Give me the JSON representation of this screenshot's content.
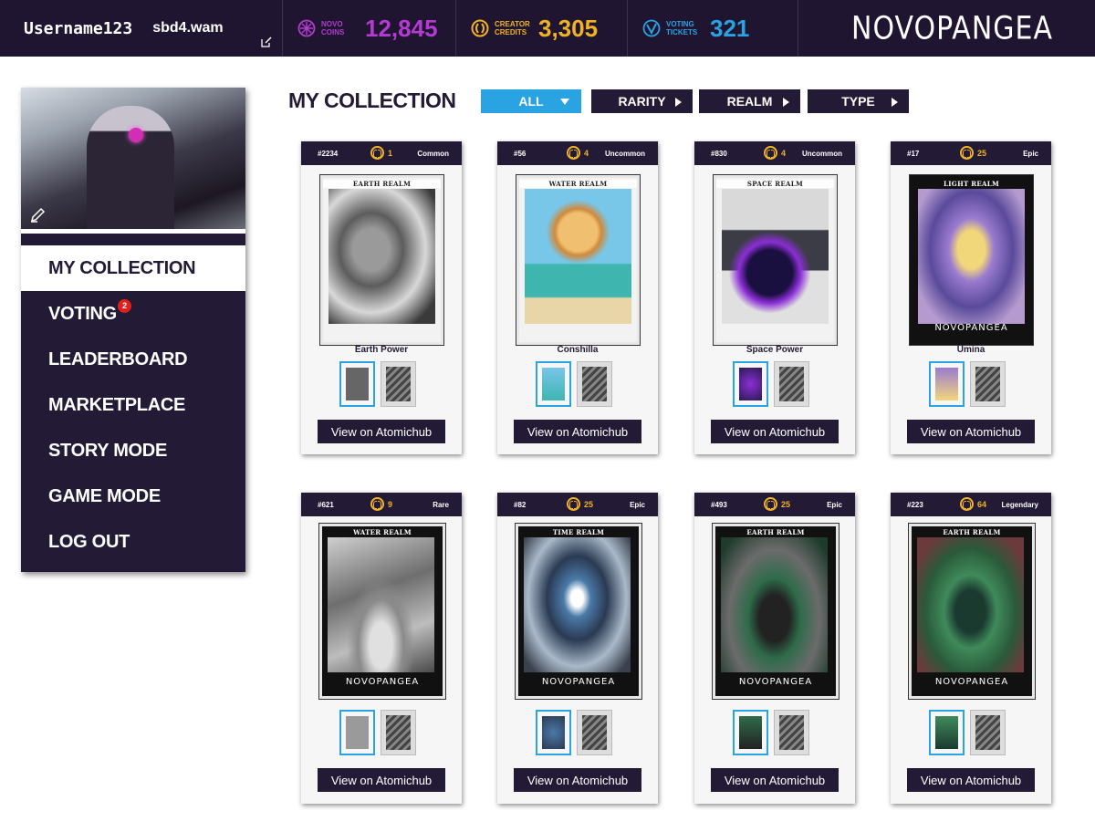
{
  "header": {
    "username": "Username123",
    "wallet": "sbd4.wam",
    "stats": [
      {
        "label": "Novo Coins",
        "value": "12,845",
        "color": "#b33bd1",
        "icon": "novo-coin-icon"
      },
      {
        "label": "Creator Credits",
        "value": "3,305",
        "color": "#f0b323",
        "icon": "creator-credit-icon"
      },
      {
        "label": "Voting Tickets",
        "value": "321",
        "color": "#29a3e2",
        "icon": "voting-ticket-icon"
      }
    ],
    "logo": "NOVOPANGEA"
  },
  "sidebar": {
    "items": [
      {
        "label": "MY COLLECTION",
        "active": true
      },
      {
        "label": "VOTING",
        "badge": "2"
      },
      {
        "label": "LEADERBOARD"
      },
      {
        "label": "MARKETPLACE"
      },
      {
        "label": "STORY MODE"
      },
      {
        "label": "GAME MODE"
      },
      {
        "label": "LOG OUT"
      }
    ]
  },
  "main": {
    "title": "MY COLLECTION",
    "filters": [
      {
        "label": "ALL",
        "active": true
      },
      {
        "label": "RARITY"
      },
      {
        "label": "REALM"
      },
      {
        "label": "TYPE"
      }
    ],
    "view_button_label": "View on Atomichub",
    "brand_label": "NOVOPANGEA",
    "cards": [
      {
        "number": "#2234",
        "count": "1",
        "rarity": "Common",
        "name": "Earth Power",
        "realm": "EARTH REALM"
      },
      {
        "number": "#56",
        "count": "4",
        "rarity": "Uncommon",
        "name": "Conshilla",
        "realm": "WATER REALM"
      },
      {
        "number": "#830",
        "count": "4",
        "rarity": "Uncommon",
        "name": "Space Power",
        "realm": "SPACE REALM"
      },
      {
        "number": "#17",
        "count": "25",
        "rarity": "Epic",
        "name": "Umina",
        "realm": "LIGHT REALM"
      },
      {
        "number": "#621",
        "count": "9",
        "rarity": "Rare",
        "name": "",
        "realm": "WATER REALM"
      },
      {
        "number": "#82",
        "count": "25",
        "rarity": "Epic",
        "name": "",
        "realm": "TIME REALM"
      },
      {
        "number": "#493",
        "count": "25",
        "rarity": "Epic",
        "name": "",
        "realm": "EARTH REALM"
      },
      {
        "number": "#223",
        "count": "64",
        "rarity": "Legendary",
        "name": "",
        "realm": "EARTH REALM"
      }
    ]
  }
}
